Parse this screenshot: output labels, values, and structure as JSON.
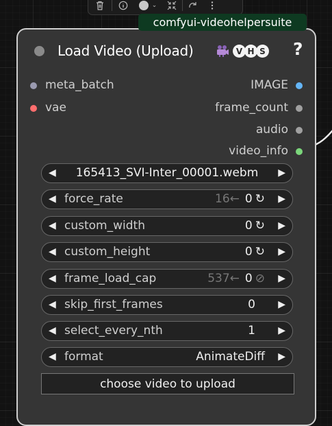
{
  "toolbar": {
    "items": [
      "delete-icon",
      "info-icon",
      "color-icon",
      "shrink-icon",
      "bypass-icon",
      "more-icon"
    ]
  },
  "source_tag": "comfyui-videohelpersuite",
  "node": {
    "title": "Load Video (Upload)",
    "title_icon": "video-camera-icon",
    "badges": [
      "V",
      "H",
      "S"
    ],
    "help": "?",
    "inputs": [
      {
        "label": "meta_batch",
        "color": "#9a9ab0"
      },
      {
        "label": "vae",
        "color": "#ff6e6e"
      }
    ],
    "outputs": [
      {
        "label": "IMAGE",
        "color": "#64b5f6"
      },
      {
        "label": "frame_count",
        "color": "#a0a0a0"
      },
      {
        "label": "audio",
        "color": "#a0a0a0"
      },
      {
        "label": "video_info",
        "color": "#7bd67b"
      }
    ],
    "widgets": {
      "video": {
        "value": "165413_SVI-Inter_00001.webm"
      },
      "force_rate": {
        "name": "force_rate",
        "ghost": "16←",
        "value": "0",
        "symbol": "↻"
      },
      "custom_width": {
        "name": "custom_width",
        "value": "0",
        "symbol": "↻"
      },
      "custom_height": {
        "name": "custom_height",
        "value": "0",
        "symbol": "↻"
      },
      "frame_load_cap": {
        "name": "frame_load_cap",
        "ghost": "537←",
        "value": "0",
        "symbol": "⊘"
      },
      "skip_first_frames": {
        "name": "skip_first_frames",
        "value": "0"
      },
      "select_every_nth": {
        "name": "select_every_nth",
        "value": "1"
      },
      "format": {
        "name": "format",
        "value": "AnimateDiff"
      }
    },
    "upload_label": "choose video to upload"
  }
}
